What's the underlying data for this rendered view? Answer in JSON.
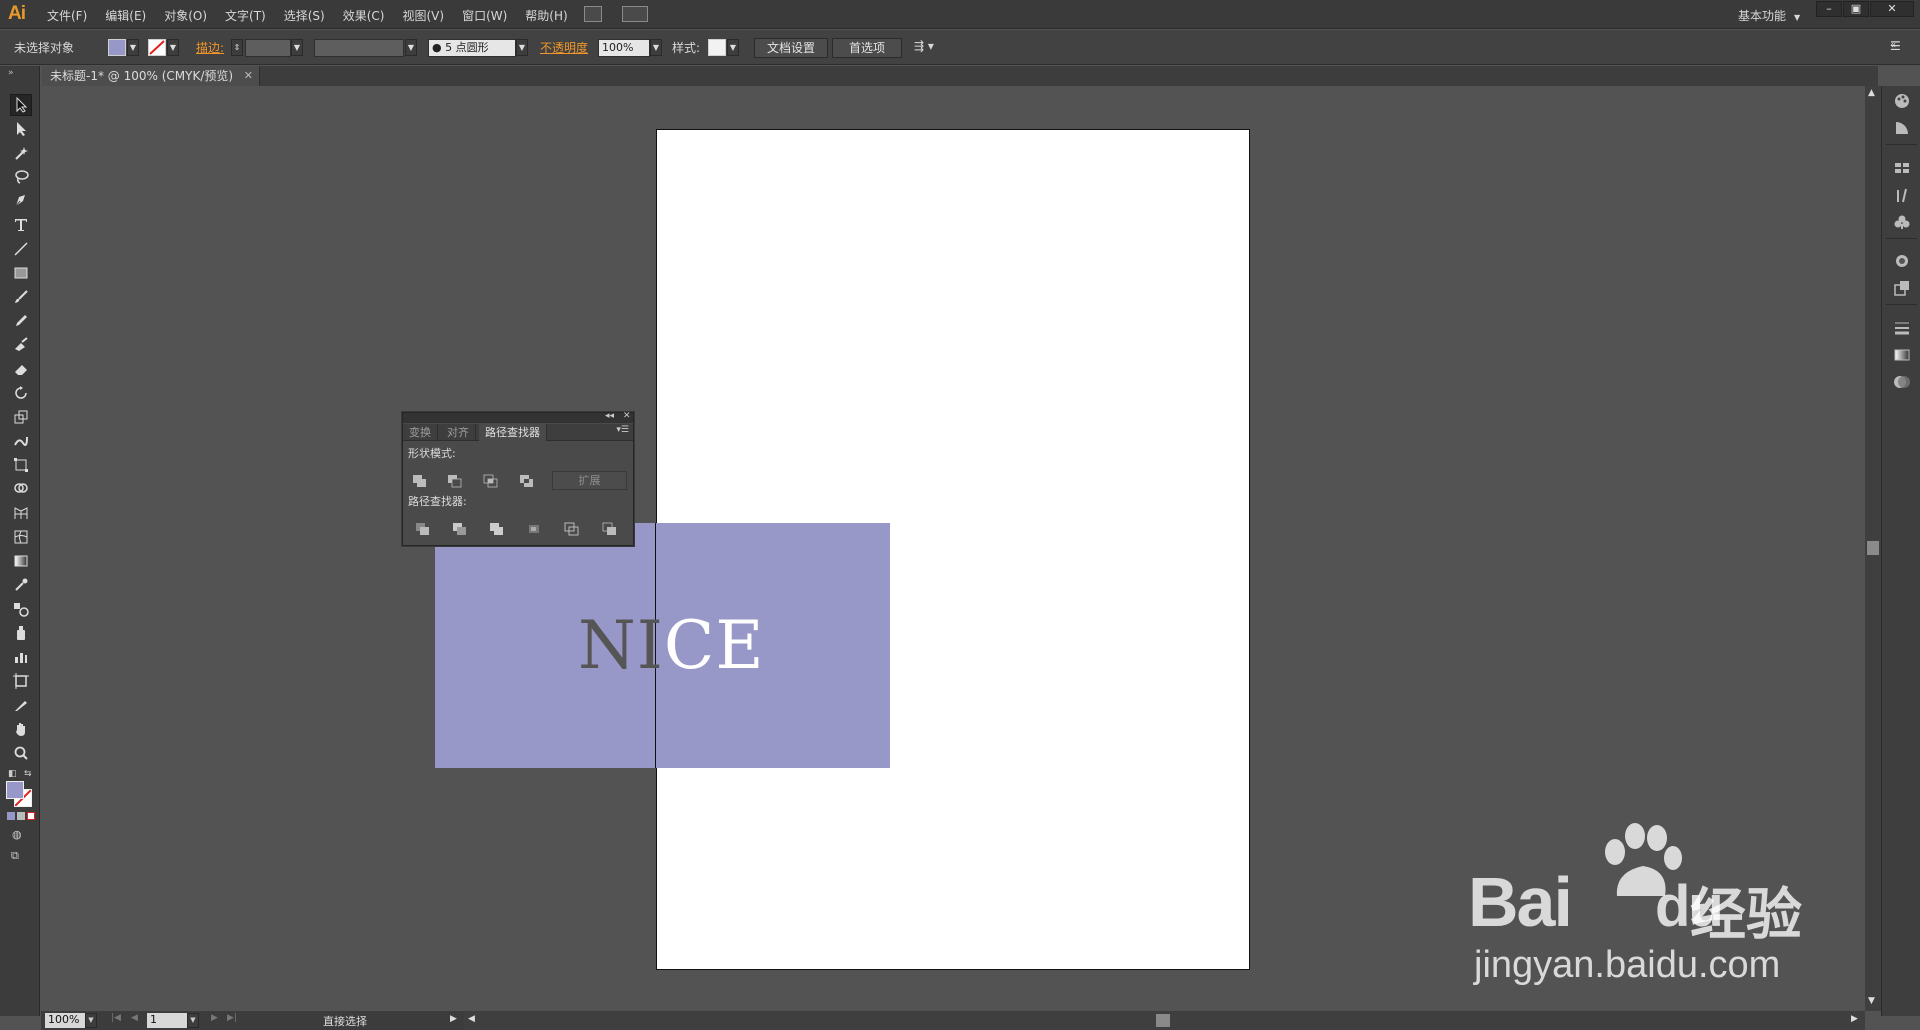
{
  "app": {
    "logo": "Ai"
  },
  "menubar": {
    "items": [
      "文件(F)",
      "编辑(E)",
      "对象(O)",
      "文字(T)",
      "选择(S)",
      "效果(C)",
      "视图(V)",
      "窗口(W)",
      "帮助(H)"
    ],
    "workspace": "基本功能",
    "window_controls": [
      "–",
      "▣",
      "✕"
    ]
  },
  "controlbar": {
    "selection_status": "未选择对象",
    "fill_color": "#9898c8",
    "stroke_label": "描边:",
    "brush_label": "5 点圆形",
    "opacity_label": "不透明度",
    "opacity_value": "100%",
    "style_label": "样式:",
    "doc_setup_button": "文档设置",
    "preferences_button": "首选项"
  },
  "document": {
    "tab_title": "未标题-1* @ 100% (CMYK/预览)",
    "text_object": {
      "left": "NI",
      "right": "CE"
    },
    "rect_color": "#9898c8"
  },
  "pathfinder_panel": {
    "tabs": [
      "变换",
      "对齐",
      "路径查找器"
    ],
    "active_tab": "路径查找器",
    "shape_modes_label": "形状模式:",
    "pathfinders_label": "路径查找器:",
    "expand_button": "扩展"
  },
  "toolbar": {
    "tools": [
      "selection-tool",
      "direct-selection-tool",
      "magic-wand-tool",
      "lasso-tool",
      "pen-tool",
      "type-tool",
      "line-tool",
      "rectangle-tool",
      "paintbrush-tool",
      "pencil-tool",
      "blob-brush-tool",
      "eraser-tool",
      "rotate-tool",
      "scale-tool",
      "warp-tool",
      "free-transform-tool",
      "shape-builder-tool",
      "perspective-grid-tool",
      "mesh-tool",
      "gradient-tool",
      "eyedropper-tool",
      "blend-tool",
      "symbol-sprayer-tool",
      "column-graph-tool",
      "artboard-tool",
      "slice-tool",
      "hand-tool",
      "zoom-tool"
    ],
    "fill_color": "#9898c8"
  },
  "statusbar": {
    "zoom": "100%",
    "artboard_number": "1",
    "current_tool": "直接选择"
  },
  "watermark": {
    "brand_bai": "Bai",
    "brand_du": "du",
    "brand_cn": "经验",
    "url": "jingyan.baidu.com"
  }
}
